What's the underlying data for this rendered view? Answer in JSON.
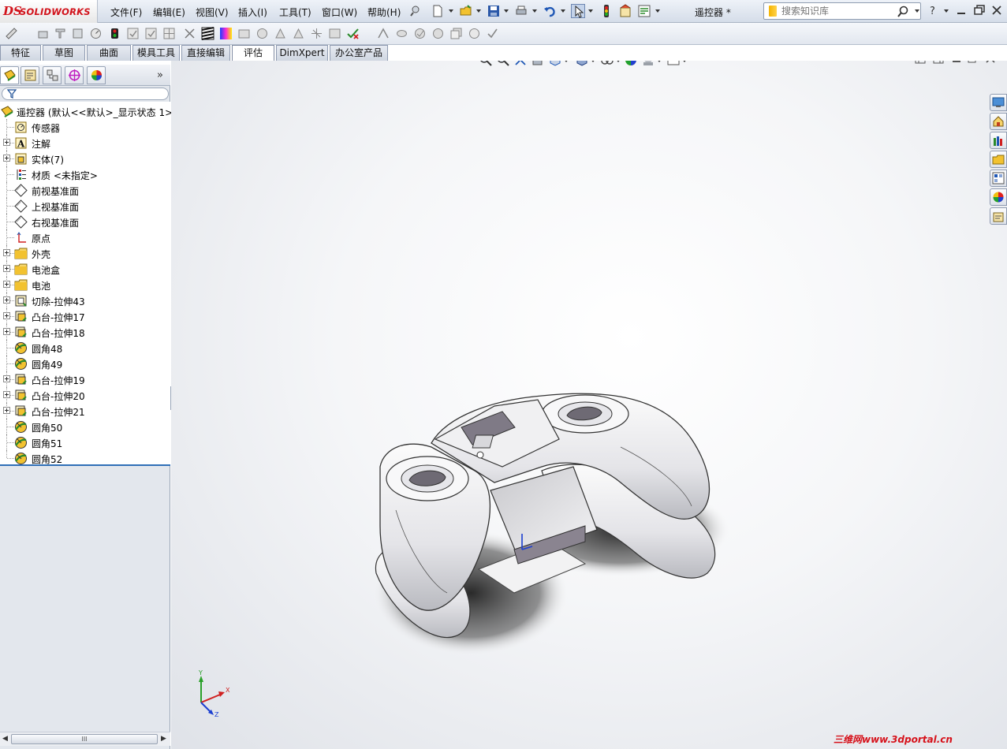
{
  "app": {
    "logo_ds": "DS",
    "logo_brand": "SOLIDWORKS",
    "document_title": "遥控器 *"
  },
  "menu": {
    "items": [
      "文件(F)",
      "编辑(E)",
      "视图(V)",
      "插入(I)",
      "工具(T)",
      "窗口(W)",
      "帮助(H)"
    ]
  },
  "search": {
    "placeholder": "搜索知识库",
    "icon": "search-icon"
  },
  "command_tabs": {
    "items": [
      "特征",
      "草图",
      "曲面",
      "模具工具",
      "直接编辑",
      "评估",
      "DimXpert",
      "办公室产品"
    ],
    "active": "评估"
  },
  "feature_tree": {
    "root_label": "遥控器 (默认<<默认>_显示状态 1>",
    "nodes": [
      {
        "label": "传感器",
        "icon": "sensor-icon",
        "expandable": false
      },
      {
        "label": "注解",
        "icon": "annotation-icon",
        "expandable": true
      },
      {
        "label": "实体(7)",
        "icon": "solid-bodies-icon",
        "expandable": true
      },
      {
        "label": "材质 <未指定>",
        "icon": "material-icon",
        "expandable": false
      },
      {
        "label": "前视基准面",
        "icon": "plane-icon",
        "expandable": false
      },
      {
        "label": "上视基准面",
        "icon": "plane-icon",
        "expandable": false
      },
      {
        "label": "右视基准面",
        "icon": "plane-icon",
        "expandable": false
      },
      {
        "label": "原点",
        "icon": "origin-icon",
        "expandable": false
      },
      {
        "label": "外壳",
        "icon": "folder-icon",
        "expandable": true
      },
      {
        "label": "电池盒",
        "icon": "folder-icon",
        "expandable": true
      },
      {
        "label": "电池",
        "icon": "folder-icon",
        "expandable": true
      },
      {
        "label": "切除-拉伸43",
        "icon": "cut-extrude-icon",
        "expandable": true
      },
      {
        "label": "凸台-拉伸17",
        "icon": "boss-extrude-icon",
        "expandable": true
      },
      {
        "label": "凸台-拉伸18",
        "icon": "boss-extrude-icon",
        "expandable": true
      },
      {
        "label": "圆角48",
        "icon": "fillet-icon",
        "expandable": false
      },
      {
        "label": "圆角49",
        "icon": "fillet-icon",
        "expandable": false
      },
      {
        "label": "凸台-拉伸19",
        "icon": "boss-extrude-icon",
        "expandable": true
      },
      {
        "label": "凸台-拉伸20",
        "icon": "boss-extrude-icon",
        "expandable": true
      },
      {
        "label": "凸台-拉伸21",
        "icon": "boss-extrude-icon",
        "expandable": true
      },
      {
        "label": "圆角50",
        "icon": "fillet-icon",
        "expandable": false
      },
      {
        "label": "圆角51",
        "icon": "fillet-icon",
        "expandable": false
      },
      {
        "label": "圆角52",
        "icon": "fillet-icon",
        "expandable": false
      }
    ]
  },
  "scrollbar": {
    "thumb_grip": "III"
  },
  "triad": {
    "x_label": "X",
    "y_label": "Y",
    "z_label": "Z"
  },
  "watermark": "三维网www.3dportal.cn",
  "colors": {
    "brand_red": "#d2131b",
    "selection_blue": "#2f6fb7",
    "panel_bg": "#e3e7ed"
  }
}
